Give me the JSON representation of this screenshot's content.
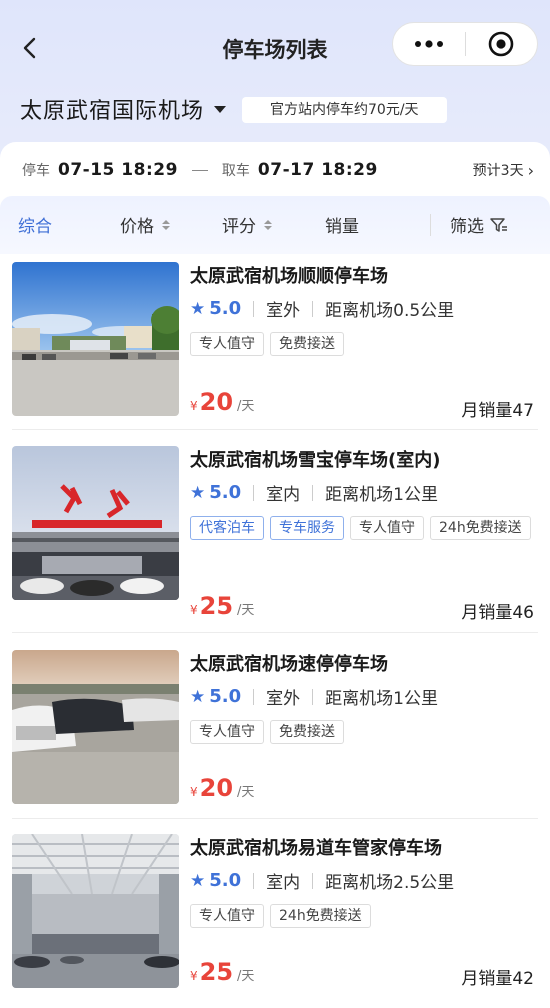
{
  "nav": {
    "title": "停车场列表"
  },
  "location": {
    "name": "太原武宿国际机场",
    "price_note": "官方站内停车约70元/天"
  },
  "booking": {
    "park_label": "停车",
    "park_time": "07-15 18:29",
    "pickup_label": "取车",
    "pickup_time": "07-17 18:29",
    "duration": "预计3天"
  },
  "filters": {
    "default": "综合",
    "price": "价格",
    "rating": "评分",
    "sales": "销量",
    "filter": "筛选"
  },
  "colors": {
    "accent": "#3f72d8",
    "price": "#e8443a"
  },
  "lots": [
    {
      "name": "太原武宿机场顺顺停车场",
      "score": "5.0",
      "type": "室外",
      "distance": "距离机场0.5公里",
      "tags": [
        {
          "text": "专人值守",
          "style": "plain"
        },
        {
          "text": "免费接送",
          "style": "plain"
        }
      ],
      "currency": "¥",
      "price": "20",
      "unit": "/天",
      "sales": "月销量47"
    },
    {
      "name": "太原武宿机场雪宝停车场(室内)",
      "score": "5.0",
      "type": "室内",
      "distance": "距离机场1公里",
      "tags": [
        {
          "text": "代客泊车",
          "style": "blue"
        },
        {
          "text": "专车服务",
          "style": "blue"
        },
        {
          "text": "专人值守",
          "style": "plain"
        },
        {
          "text": "24h免费接送",
          "style": "plain"
        }
      ],
      "currency": "¥",
      "price": "25",
      "unit": "/天",
      "sales": "月销量46"
    },
    {
      "name": "太原武宿机场速停停车场",
      "score": "5.0",
      "type": "室外",
      "distance": "距离机场1公里",
      "tags": [
        {
          "text": "专人值守",
          "style": "plain"
        },
        {
          "text": "免费接送",
          "style": "plain"
        }
      ],
      "currency": "¥",
      "price": "20",
      "unit": "/天",
      "sales": ""
    },
    {
      "name": "太原武宿机场易道车管家停车场",
      "score": "5.0",
      "type": "室内",
      "distance": "距离机场2.5公里",
      "tags": [
        {
          "text": "专人值守",
          "style": "plain"
        },
        {
          "text": "24h免费接送",
          "style": "plain"
        }
      ],
      "currency": "¥",
      "price": "25",
      "unit": "/天",
      "sales": "月销量42"
    }
  ]
}
